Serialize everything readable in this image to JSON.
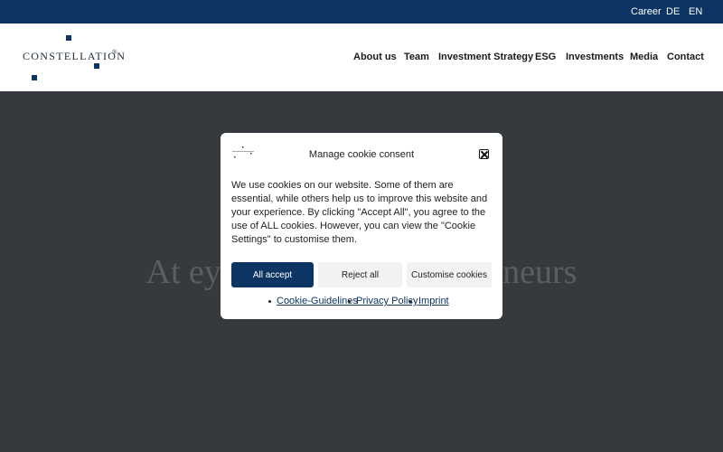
{
  "topbar": {
    "career": "Career",
    "lang_de": "DE",
    "lang_en": "EN"
  },
  "brand": {
    "name": "CONSTELLATION",
    "reg": "®",
    "color": "#0d3563"
  },
  "nav": {
    "about": "About us",
    "team": "Team",
    "strategy": "Investment Strategy",
    "esg": "ESG",
    "investments": "Investments",
    "media": "Media",
    "contact": "Contact"
  },
  "hero": {
    "title": "At eye level with entrepreneurs"
  },
  "modal": {
    "title": "Manage cookie consent",
    "body": "We use cookies on our website. Some of them are essential, while others help us to improve this website and your experience. By clicking \"Accept All\", you agree to the use of ALL cookies. However, you can view the \"Cookie Settings\" to customise them.",
    "accept_label": "All accept",
    "reject_label": "Reject all",
    "customise_label": "Customise cookies",
    "links": [
      "Cookie-Guidelines",
      "Privacy Policy",
      "Imprint"
    ],
    "close_icon": "close-icon"
  }
}
